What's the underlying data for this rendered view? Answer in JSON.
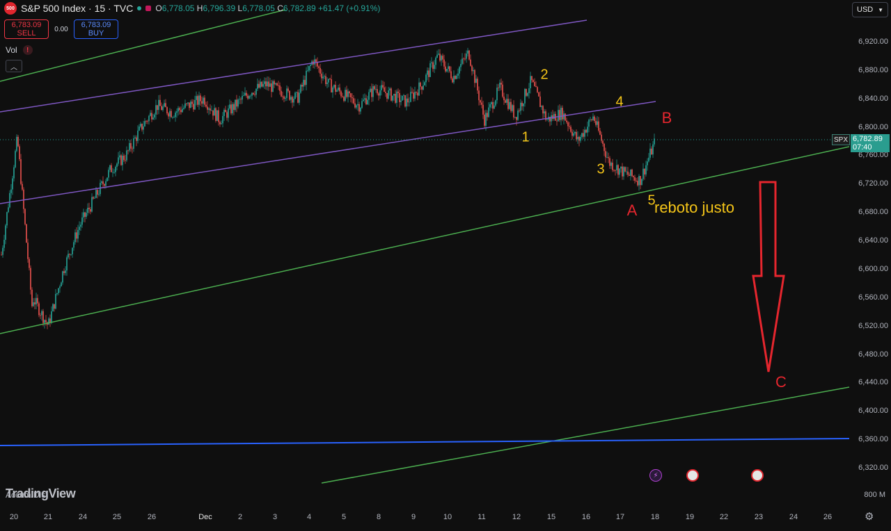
{
  "header": {
    "symbol_badge": "500",
    "title": "S&P 500 Index · 15 · TVC",
    "ohlc": {
      "o_label": "O",
      "o": "6,778.05",
      "h_label": "H",
      "h": "6,796.39",
      "l_label": "L",
      "l": "6,778.05",
      "c_label": "C",
      "c": "6,782.89",
      "change": "+61.47 (+0.91%)"
    },
    "currency": "USD"
  },
  "trade": {
    "sell_price": "6,783.09",
    "sell_label": "SELL",
    "spread": "0.00",
    "buy_price": "6,783.09",
    "buy_label": "BUY"
  },
  "indicators": {
    "vol_label": "Vol",
    "warning_icon": "!",
    "collapse_icon": "chevron-up-icon",
    "accum_label": "Accum/Dist",
    "volume_axis": "800 M"
  },
  "watermark": "TradingView",
  "price_axis": [
    "6,920.00",
    "6,880.00",
    "6,840.00",
    "6,800.00",
    "6,760.00",
    "6,720.00",
    "6,680.00",
    "6,640.00",
    "6,600.00",
    "6,560.00",
    "6,520.00",
    "6,480.00",
    "6,440.00",
    "6,400.00",
    "6,360.00",
    "6,320.00"
  ],
  "last_price": {
    "tag": "SPX",
    "price": "6,782.89",
    "countdown": "07:40"
  },
  "time_axis": [
    {
      "label": "20"
    },
    {
      "label": "21"
    },
    {
      "label": "24"
    },
    {
      "label": "25"
    },
    {
      "label": "26"
    },
    {
      "label": "Dec",
      "month": true
    },
    {
      "label": "2"
    },
    {
      "label": "3"
    },
    {
      "label": "4"
    },
    {
      "label": "5"
    },
    {
      "label": "8"
    },
    {
      "label": "9"
    },
    {
      "label": "10"
    },
    {
      "label": "11"
    },
    {
      "label": "12"
    },
    {
      "label": "15"
    },
    {
      "label": "16"
    },
    {
      "label": "17"
    },
    {
      "label": "18"
    },
    {
      "label": "19"
    },
    {
      "label": "22"
    },
    {
      "label": "23"
    },
    {
      "label": "24"
    },
    {
      "label": "26"
    }
  ],
  "annotations": {
    "wave1": "1",
    "wave2": "2",
    "wave3": "3",
    "wave4": "4",
    "wave5": "5",
    "labelA": "A",
    "labelB": "B",
    "labelC": "C",
    "note": "reboto justo"
  },
  "colors": {
    "up": "#26a69a",
    "down": "#ef5350",
    "green_line": "#4caf50",
    "purple_line": "#7e57c2",
    "blue_line": "#2962ff",
    "arrow": "#e6262e",
    "label_yellow": "#f5c518",
    "label_red": "#e6262e"
  },
  "chart_data": {
    "type": "candlestick",
    "symbol": "SPX",
    "interval": "15",
    "y_range": [
      6300,
      6940
    ],
    "x_labels": [
      "20",
      "21",
      "24",
      "25",
      "26",
      "Dec",
      "2",
      "3",
      "4",
      "5",
      "8",
      "9",
      "10",
      "11",
      "12",
      "15",
      "16",
      "17",
      "18",
      "19",
      "22",
      "23",
      "24",
      "26"
    ],
    "price_path": [
      [
        6620,
        6780
      ],
      [
        6790,
        6540
      ],
      [
        6560,
        6520
      ],
      [
        6520,
        6600
      ],
      [
        6600,
        6660
      ],
      [
        6660,
        6700
      ],
      [
        6700,
        6740
      ],
      [
        6740,
        6760
      ],
      [
        6760,
        6800
      ],
      [
        6800,
        6830
      ],
      [
        6830,
        6820
      ],
      [
        6820,
        6830
      ],
      [
        6830,
        6840
      ],
      [
        6840,
        6810
      ],
      [
        6810,
        6830
      ],
      [
        6830,
        6850
      ],
      [
        6850,
        6860
      ],
      [
        6860,
        6850
      ],
      [
        6850,
        6840
      ],
      [
        6840,
        6895
      ],
      [
        6895,
        6860
      ],
      [
        6860,
        6845
      ],
      [
        6845,
        6830
      ],
      [
        6830,
        6855
      ],
      [
        6855,
        6845
      ],
      [
        6845,
        6835
      ],
      [
        6835,
        6860
      ],
      [
        6860,
        6900
      ],
      [
        6900,
        6870
      ],
      [
        6870,
        6905
      ],
      [
        6905,
        6810
      ],
      [
        6810,
        6855
      ],
      [
        6855,
        6815
      ],
      [
        6815,
        6865
      ],
      [
        6865,
        6810
      ],
      [
        6810,
        6820
      ],
      [
        6820,
        6780
      ],
      [
        6780,
        6815
      ],
      [
        6815,
        6750
      ],
      [
        6750,
        6735
      ],
      [
        6735,
        6725
      ],
      [
        6725,
        6782
      ]
    ]
  }
}
